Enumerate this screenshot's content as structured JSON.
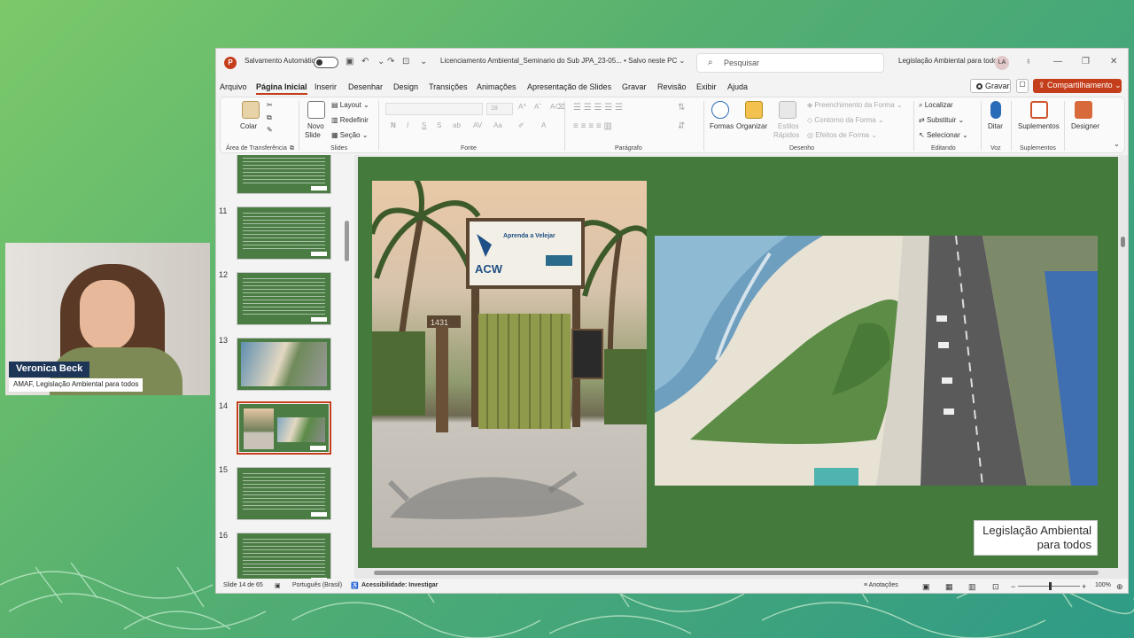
{
  "webcam": {
    "name": "Veronica Beck",
    "org": "AMAF, Legislação Ambiental para todos"
  },
  "titlebar": {
    "app_icon": "powerpoint-icon",
    "autosave_label": "Salvamento Automático",
    "autosave_state": "off",
    "file_title": "Licenciamento Ambiental_Seminario do Sub JPA_23-05... • Salvo neste PC ⌄",
    "search_placeholder": "Pesquisar",
    "account_name": "Legislação Ambiental para todos",
    "account_initials": "LA"
  },
  "menu": {
    "tabs": [
      "Arquivo",
      "Página Inicial",
      "Inserir",
      "Desenhar",
      "Design",
      "Transições",
      "Animações",
      "Apresentação de Slides",
      "Gravar",
      "Revisão",
      "Exibir",
      "Ajuda"
    ],
    "active": "Página Inicial",
    "record_label": "Gravar",
    "share_label": "Compartilhamento"
  },
  "ribbon": {
    "clipboard": {
      "paste": "Colar",
      "label": "Área de Transferência"
    },
    "slides": {
      "new_slide_1": "Novo",
      "new_slide_2": "Slide",
      "layout": "Layout",
      "reset": "Redefinir",
      "section": "Seção",
      "label": "Slides"
    },
    "font": {
      "size": "18",
      "label": "Fonte",
      "bold": "N",
      "italic": "I",
      "underline": "S",
      "strike": "S"
    },
    "paragraph": {
      "label": "Parágrafo"
    },
    "drawing": {
      "shapes": "Formas",
      "arrange": "Organizar",
      "quick_styles_1": "Estilos",
      "quick_styles_2": "Rápidos",
      "fill": "Preenchimento da Forma",
      "outline": "Contorno da Forma",
      "effects": "Efeitos de Forma",
      "label": "Desenho"
    },
    "editing": {
      "find": "Localizar",
      "replace": "Substituir",
      "select": "Selecionar",
      "label": "Editando"
    },
    "voice": {
      "dictate": "Ditar",
      "label": "Voz"
    },
    "addins": {
      "addins": "Suplementos",
      "label": "Suplementos"
    },
    "designer": {
      "label": "Designer"
    }
  },
  "thumbnails": [
    "11",
    "12",
    "13",
    "14",
    "15",
    "16"
  ],
  "slide": {
    "sign_text_1": "ACW",
    "sign_text_2": "Aprenda a Velejar",
    "gate_number": "1431",
    "logo_line1": "Legislação Ambiental",
    "logo_line2": "para todos"
  },
  "status": {
    "slide_info": "Slide 14 de 65",
    "language": "Português (Brasil)",
    "accessibility": "Acessibilidade: Investigar",
    "notes": "Anotações",
    "zoom": "100%"
  }
}
